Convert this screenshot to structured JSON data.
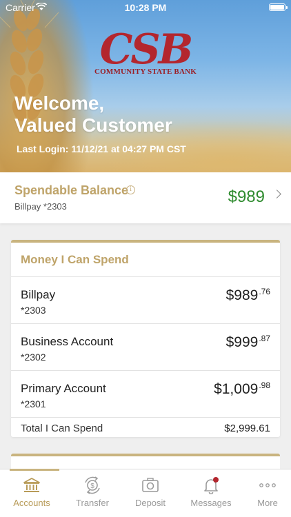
{
  "status_bar": {
    "carrier": "Carrier",
    "time": "10:28 PM"
  },
  "brand": {
    "logo_text": "CSB",
    "bank_name": "COMMUNITY STATE BANK",
    "brand_red": "#b3262e",
    "accent_gold": "#c9b47f"
  },
  "hero": {
    "welcome_line1": "Welcome,",
    "welcome_line2": "Valued Customer",
    "last_login": "Last Login: 11/12/21 at 04:27 PM CST"
  },
  "spendable": {
    "title": "Spendable Balance",
    "info_icon": "i",
    "account": "Billpay *2303",
    "amount": "$989",
    "amount_color": "#2e8b2e"
  },
  "money_card": {
    "title": "Money I Can Spend",
    "accounts": [
      {
        "name": "Billpay",
        "number": "*2303",
        "dollars": "$989",
        "cents": ".76"
      },
      {
        "name": "Business Account",
        "number": "*2302",
        "dollars": "$999",
        "cents": ".87"
      },
      {
        "name": "Primary Account",
        "number": "*2301",
        "dollars": "$1,009",
        "cents": ".98"
      }
    ],
    "total_label": "Total I Can Spend",
    "total_value": "$2,999.61"
  },
  "tabs": [
    {
      "label": "Accounts",
      "icon": "bank-icon",
      "active": true
    },
    {
      "label": "Transfer",
      "icon": "transfer-icon",
      "active": false
    },
    {
      "label": "Deposit",
      "icon": "camera-icon",
      "active": false
    },
    {
      "label": "Messages",
      "icon": "bell-icon",
      "active": false,
      "badge": true
    },
    {
      "label": "More",
      "icon": "more-dots-icon",
      "active": false
    }
  ]
}
